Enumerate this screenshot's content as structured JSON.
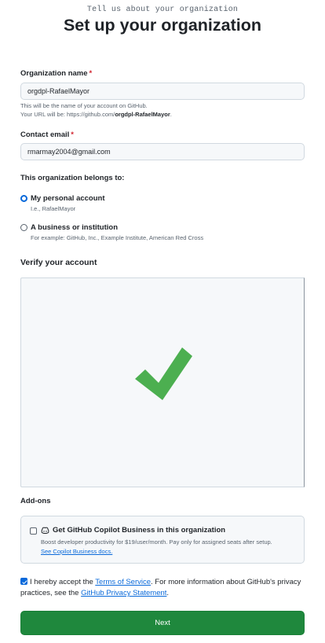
{
  "header": {
    "eyebrow": "Tell us about your organization",
    "title": "Set up your organization"
  },
  "org_name": {
    "label": "Organization name",
    "required_mark": "*",
    "value": "orgdpl-RafaelMayor",
    "note_line1": "This will be the name of your account on GitHub.",
    "note_line2_prefix": "Your URL will be: https://github.com/",
    "note_line2_bold": "orgdpl-RafaelMayor",
    "note_line2_suffix": "."
  },
  "contact_email": {
    "label": "Contact email",
    "required_mark": "*",
    "value": "rmarmay2004@gmail.com"
  },
  "belongs_to": {
    "label": "This organization belongs to:",
    "options": [
      {
        "title": "My personal account",
        "sub": "I.e., RafaelMayor",
        "checked": true
      },
      {
        "title": "A business or institution",
        "sub": "For example: GitHub, Inc., Example Institute, American Red Cross",
        "checked": false
      }
    ]
  },
  "verify": {
    "heading": "Verify your account",
    "check_color": "#4caf50"
  },
  "addons": {
    "heading": "Add-ons",
    "copilot_icon": "copilot-icon",
    "copilot_title": "Get GitHub Copilot Business in this organization",
    "copilot_desc": "Boost developer productivity for $19/user/month. Pay only for assigned seats after setup.",
    "copilot_link": "See Copilot Business docs.",
    "checked": false
  },
  "terms": {
    "checked": true,
    "text_before": "I hereby accept the ",
    "tos_link": "Terms of Service",
    "text_middle": ". For more information about GitHub's privacy practices, see the ",
    "privacy_link": "GitHub Privacy Statement",
    "text_after": "."
  },
  "submit": {
    "label": "Next"
  },
  "colors": {
    "primary_button": "#1f883d",
    "accent": "#0969da",
    "required": "#d1242f"
  }
}
